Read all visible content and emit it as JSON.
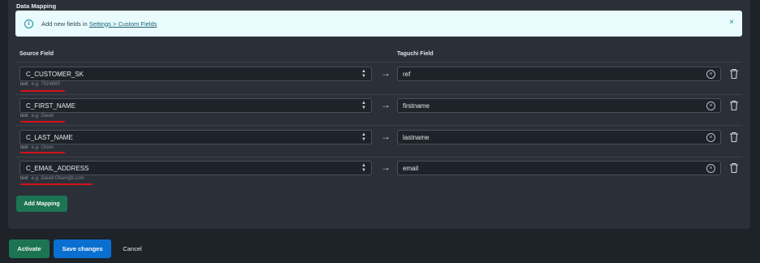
{
  "section": {
    "title": "Data Mapping"
  },
  "banner": {
    "text": "Add new fields in ",
    "link": "Settings > Custom Fields",
    "info_icon": "info-icon",
    "close_icon": "close-icon",
    "close_glyph": "×"
  },
  "columns": {
    "source": "Source Field",
    "target": "Taguchi Field"
  },
  "mappings": [
    {
      "source": "C_CUSTOMER_SK",
      "target": "ref",
      "type": "text",
      "example": "e.g. 7014865"
    },
    {
      "source": "C_FIRST_NAME",
      "target": "firstname",
      "type": "text",
      "example": "e.g. David"
    },
    {
      "source": "C_LAST_NAME",
      "target": "lastname",
      "type": "text",
      "example": "e.g. Olsen"
    },
    {
      "source": "C_EMAIL_ADDRESS",
      "target": "email",
      "type": "text",
      "example": "e.g. David.Olsen@t.com"
    }
  ],
  "arrow_glyph": "→",
  "buttons": {
    "add_mapping": "Add Mapping",
    "activate": "Activate",
    "save": "Save changes",
    "cancel": "Cancel"
  },
  "colors": {
    "accent_green": "#1d7455",
    "accent_blue": "#0a6fd0",
    "annotation_red": "#d6121b",
    "banner_bg": "#e9fbfc"
  }
}
